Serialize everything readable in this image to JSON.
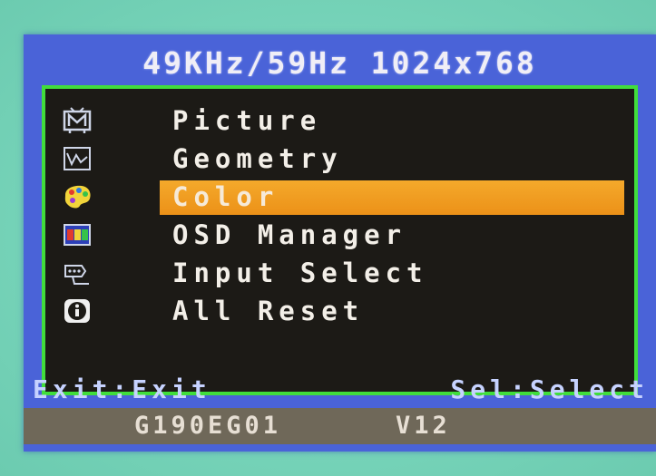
{
  "osd": {
    "resolution": "49KHz/59Hz  1024x768",
    "menu": {
      "items": [
        {
          "label": "Picture",
          "icon": "picture-icon"
        },
        {
          "label": "Geometry",
          "icon": "geometry-icon"
        },
        {
          "label": "Color",
          "icon": "color-palette-icon",
          "selected": true
        },
        {
          "label": "OSD Manager",
          "icon": "osd-icon"
        },
        {
          "label": "Input Select",
          "icon": "input-select-icon"
        },
        {
          "label": "All Reset",
          "icon": "info-reset-icon"
        }
      ],
      "selected_index": 2
    },
    "footer": {
      "exit_hint": "Exit:Exit",
      "select_hint": "Sel:Select"
    },
    "model_bar": {
      "model": "G190EG01",
      "version": "V12"
    }
  },
  "colors": {
    "osd_background": "#4a63d8",
    "menu_background": "#1c1a16",
    "menu_border": "#41dd3c",
    "selection": "#ef9a20",
    "model_bar": "#6f6859"
  }
}
